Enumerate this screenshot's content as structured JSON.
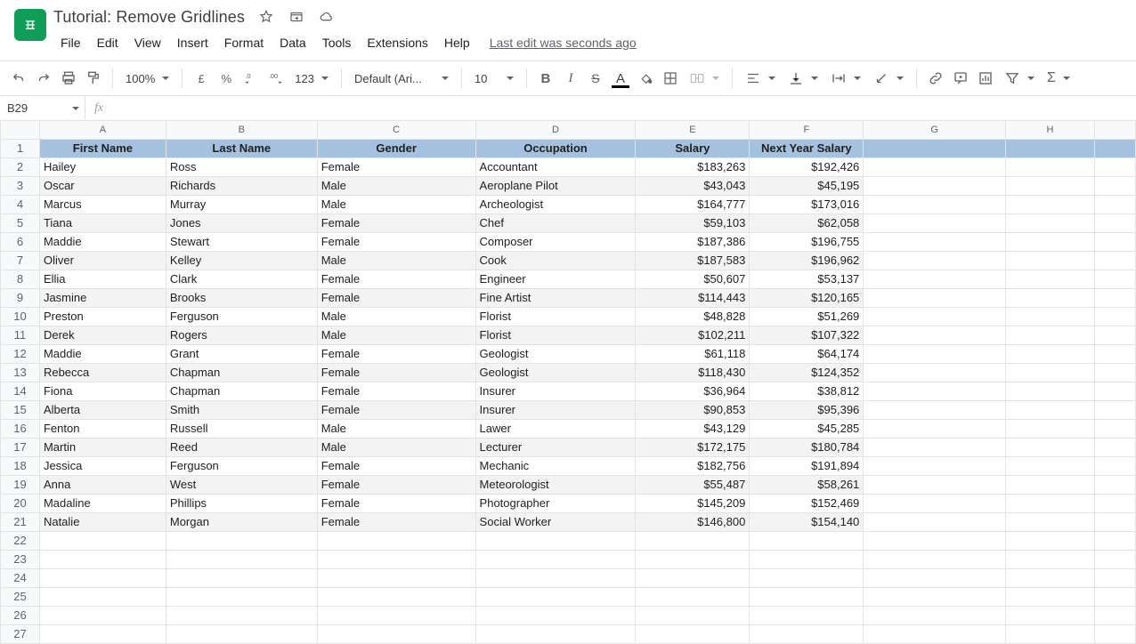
{
  "doc": {
    "title": "Tutorial: Remove Gridlines"
  },
  "menubar": {
    "file": "File",
    "edit": "Edit",
    "view": "View",
    "insert": "Insert",
    "format": "Format",
    "data": "Data",
    "tools": "Tools",
    "extensions": "Extensions",
    "help": "Help",
    "last_edit": "Last edit was seconds ago"
  },
  "toolbar": {
    "zoom": "100%",
    "currency": "£",
    "percent": "%",
    "dec_dec": ".0",
    "inc_dec": ".00",
    "more_formats": "123",
    "font": "Default (Ari...",
    "font_size": "10"
  },
  "namebox": {
    "ref": "B29"
  },
  "columns": [
    "A",
    "B",
    "C",
    "D",
    "E",
    "F",
    "G",
    "H",
    ""
  ],
  "headers": [
    "First Name",
    "Last Name",
    "Gender",
    "Occupation",
    "Salary",
    "Next Year Salary"
  ],
  "chart_data": {
    "type": "table",
    "columns": [
      "First Name",
      "Last Name",
      "Gender",
      "Occupation",
      "Salary",
      "Next Year Salary"
    ],
    "rows": [
      [
        "Hailey",
        "Ross",
        "Female",
        "Accountant",
        "$183,263",
        "$192,426"
      ],
      [
        "Oscar",
        "Richards",
        "Male",
        "Aeroplane Pilot",
        "$43,043",
        "$45,195"
      ],
      [
        "Marcus",
        "Murray",
        "Male",
        "Archeologist",
        "$164,777",
        "$173,016"
      ],
      [
        "Tiana",
        "Jones",
        "Female",
        "Chef",
        "$59,103",
        "$62,058"
      ],
      [
        "Maddie",
        "Stewart",
        "Female",
        "Composer",
        "$187,386",
        "$196,755"
      ],
      [
        "Oliver",
        "Kelley",
        "Male",
        "Cook",
        "$187,583",
        "$196,962"
      ],
      [
        "Ellia",
        "Clark",
        "Female",
        "Engineer",
        "$50,607",
        "$53,137"
      ],
      [
        "Jasmine",
        "Brooks",
        "Female",
        "Fine Artist",
        "$114,443",
        "$120,165"
      ],
      [
        "Preston",
        "Ferguson",
        "Male",
        "Florist",
        "$48,828",
        "$51,269"
      ],
      [
        "Derek",
        "Rogers",
        "Male",
        "Florist",
        "$102,211",
        "$107,322"
      ],
      [
        "Maddie",
        "Grant",
        "Female",
        "Geologist",
        "$61,118",
        "$64,174"
      ],
      [
        "Rebecca",
        "Chapman",
        "Female",
        "Geologist",
        "$118,430",
        "$124,352"
      ],
      [
        "Fiona",
        "Chapman",
        "Female",
        "Insurer",
        "$36,964",
        "$38,812"
      ],
      [
        "Alberta",
        "Smith",
        "Female",
        "Insurer",
        "$90,853",
        "$95,396"
      ],
      [
        "Fenton",
        "Russell",
        "Male",
        "Lawer",
        "$43,129",
        "$45,285"
      ],
      [
        "Martin",
        "Reed",
        "Male",
        "Lecturer",
        "$172,175",
        "$180,784"
      ],
      [
        "Jessica",
        "Ferguson",
        "Female",
        "Mechanic",
        "$182,756",
        "$191,894"
      ],
      [
        "Anna",
        "West",
        "Female",
        "Meteorologist",
        "$55,487",
        "$58,261"
      ],
      [
        "Madaline",
        "Phillips",
        "Female",
        "Photographer",
        "$145,209",
        "$152,469"
      ],
      [
        "Natalie",
        "Morgan",
        "Female",
        "Social Worker",
        "$146,800",
        "$154,140"
      ]
    ]
  },
  "empty_rows": 6
}
